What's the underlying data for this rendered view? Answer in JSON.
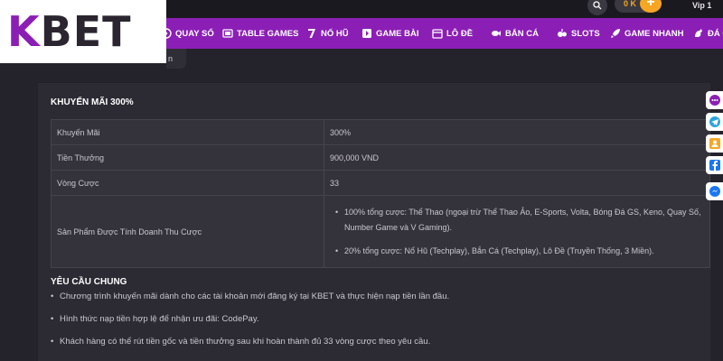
{
  "header": {
    "logo_text_k": "K",
    "logo_text_rest": "BET",
    "balance_text": "0 K",
    "plus_label": "+",
    "vip_label": "Vip 1"
  },
  "nav": {
    "items": [
      {
        "label": "QUAY SỐ",
        "icon": "dice-icon"
      },
      {
        "label": "TABLE GAMES",
        "icon": "cards-icon"
      },
      {
        "label": "NỔ HŨ",
        "icon": "seven-icon"
      },
      {
        "label": "GAME BÀI",
        "icon": "card-game-icon"
      },
      {
        "label": "LÔ ĐỀ",
        "icon": "lottery-icon"
      },
      {
        "label": "BẮN CÁ",
        "icon": "fish-icon"
      },
      {
        "label": "SLOTS",
        "icon": "slots-icon"
      },
      {
        "label": "GAME NHANH",
        "icon": "rocket-icon"
      },
      {
        "label": "ĐÁ G",
        "icon": "rooster-icon"
      }
    ]
  },
  "sub_strip_text": "n",
  "promo": {
    "title": "KHUYẾN MÃI 300%",
    "rows": [
      {
        "label": "Khuyến Mãi",
        "value": "300%"
      },
      {
        "label": "Tiền Thưởng",
        "value": "900,000 VND"
      },
      {
        "label": "Vòng Cược",
        "value": "33"
      }
    ],
    "products_label": "Sản Phẩm Được Tính Doanh Thu Cược",
    "products": [
      "100% tổng cược: Thể Thao (ngoại trừ Thể Thao Ảo, E-Sports, Volta, Bóng Đá GS, Keno, Quay Số, Number Game và V Gaming).",
      "20% tổng cược: Nổ Hũ (Techplay), Bắn Cá (Techplay), Lô Đề (Truyền Thống, 3 Miền)."
    ]
  },
  "requirements": {
    "title": "YÊU CẦU CHUNG",
    "items": [
      "Chương trình khuyến mãi dành cho các tài khoản mới đăng ký tại KBET và thực hiện nạp tiền lần đầu.",
      "Hình thức nạp tiền hợp lệ để nhận ưu đãi: CodePay.",
      "Khách hàng có thể rút tiền gốc và tiền thưởng sau khi hoàn thành đủ 33 vòng cược theo yêu cầu."
    ]
  },
  "social": [
    "chat-icon",
    "telegram-icon",
    "contacts-icon",
    "facebook-icon",
    "messenger-icon"
  ],
  "colors": {
    "nav_bg": "#8b1fb5",
    "page_bg": "#24222b",
    "accent_orange": "#f5a623"
  }
}
